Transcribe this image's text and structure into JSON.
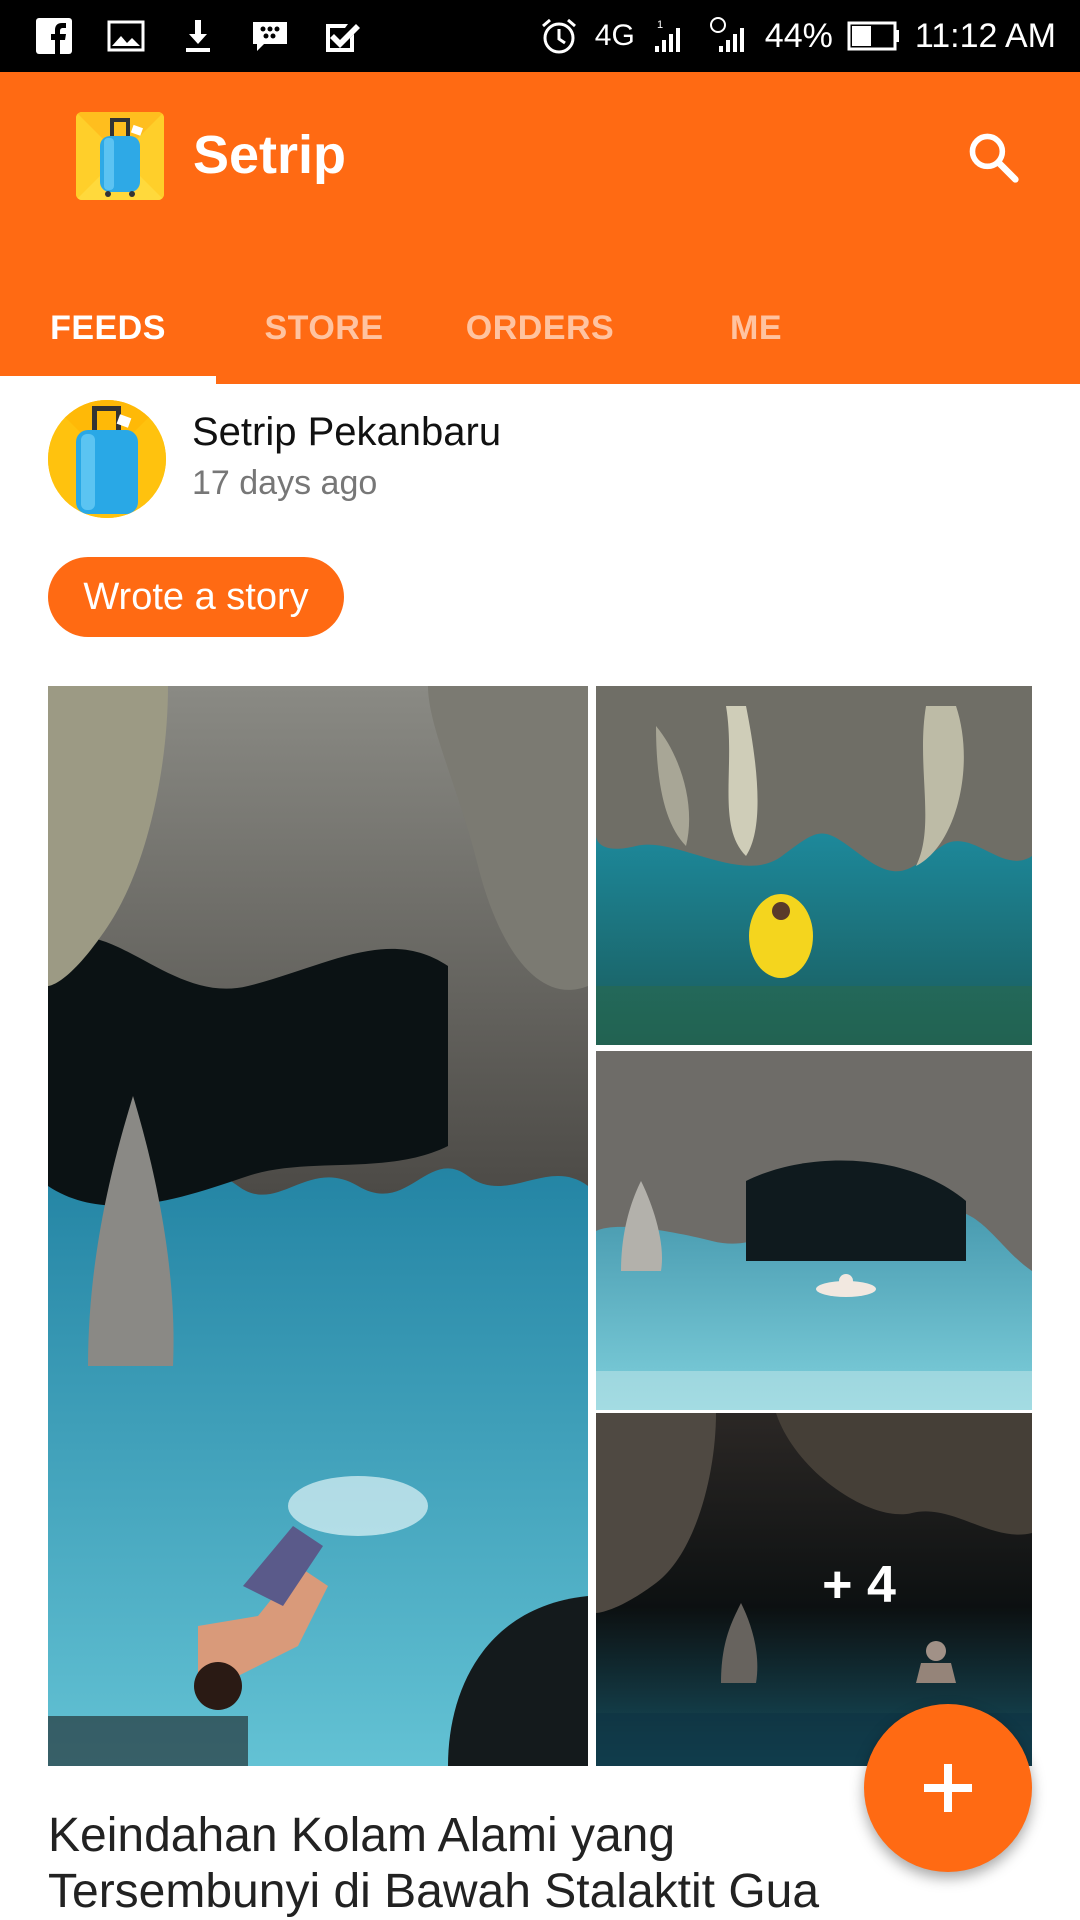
{
  "status_bar": {
    "left_icons": [
      "facebook-icon",
      "gallery-icon",
      "download-icon",
      "bbm-icon",
      "task-icon"
    ],
    "network": "4G",
    "sim2_label": "2",
    "battery": "44%",
    "time": "11:12 AM"
  },
  "app_bar": {
    "title": "Setrip",
    "color": "#ff6a13"
  },
  "tabs": [
    {
      "label": "FEEDS",
      "active": true
    },
    {
      "label": "STORE",
      "active": false
    },
    {
      "label": "ORDERS",
      "active": false
    },
    {
      "label": "ME",
      "active": false
    }
  ],
  "feed": {
    "author": "Setrip Pekanbaru",
    "time": "17 days ago",
    "action_label": "Wrote a story",
    "more_photos_label": "+ 4",
    "title": "Keindahan Kolam Alami yang Tersembunyi di Bawah Stalaktit Gua"
  }
}
